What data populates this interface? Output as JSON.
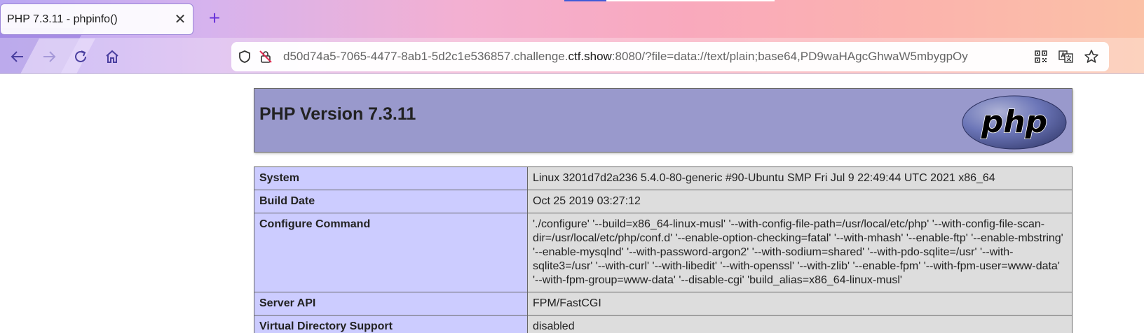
{
  "browser": {
    "tab_title": "PHP 7.3.11 - phpinfo()",
    "tab_close_glyph": "✕",
    "new_tab_glyph": "+",
    "url_host_prefix": "d50d74a5-7065-4477-8ab1-5d2c1e536857.challenge.",
    "url_host_domain": "ctf.show",
    "url_rest": ":8080/?file=data://text/plain;base64,PD9waHAgcGhwaW5mbygpOy"
  },
  "page": {
    "title": "PHP Version 7.3.11",
    "logo_text": "php",
    "rows": [
      {
        "label": "System",
        "value": "Linux 3201d7d2a236 5.4.0-80-generic #90-Ubuntu SMP Fri Jul 9 22:49:44 UTC 2021 x86_64"
      },
      {
        "label": "Build Date",
        "value": "Oct 25 2019 03:27:12"
      },
      {
        "label": "Configure Command",
        "value": "'./configure' '--build=x86_64-linux-musl' '--with-config-file-path=/usr/local/etc/php' '--with-config-file-scan-dir=/usr/local/etc/php/conf.d' '--enable-option-checking=fatal' '--with-mhash' '--enable-ftp' '--enable-mbstring' '--enable-mysqlnd' '--with-password-argon2' '--with-sodium=shared' '--with-pdo-sqlite=/usr' '--with-sqlite3=/usr' '--with-curl' '--with-libedit' '--with-openssl' '--with-zlib' '--enable-fpm' '--with-fpm-user=www-data' '--with-fpm-group=www-data' '--disable-cgi' 'build_alias=x86_64-linux-musl'"
      },
      {
        "label": "Server API",
        "value": "FPM/FastCGI"
      },
      {
        "label": "Virtual Directory Support",
        "value": "disabled"
      }
    ]
  },
  "colors": {
    "accent": "#6a34d9",
    "header_bg": "#9999cc",
    "label_bg": "#ccccff",
    "value_bg": "#dddddd"
  },
  "icons": [
    "close-icon",
    "plus-icon",
    "back-arrow-icon",
    "forward-arrow-icon",
    "reload-icon",
    "home-icon",
    "shield-icon",
    "insecure-lock-icon",
    "qr-code-icon",
    "translate-icon",
    "star-icon"
  ]
}
